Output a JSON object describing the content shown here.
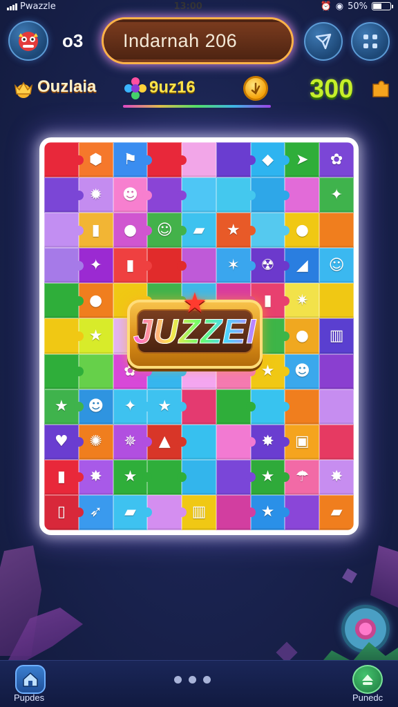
{
  "status_bar": {
    "app_name": "Pwazzle",
    "time": "13:00",
    "battery": "50%",
    "battery_level": 0.5
  },
  "header": {
    "level": "o3",
    "title": "Indarnah 206",
    "player_name": "Ouzlaia",
    "puzzle_code": "9uz16",
    "score": "300"
  },
  "board": {
    "logo_text": "JUZZEI",
    "tiles": [
      {
        "color": "#e8283a",
        "glyph": ""
      },
      {
        "color": "#f5782b",
        "glyph": "⬢"
      },
      {
        "color": "#3a8df0",
        "glyph": "⚑"
      },
      {
        "color": "#e8283a",
        "glyph": ""
      },
      {
        "color": "#f2a6e8",
        "glyph": ""
      },
      {
        "color": "#6a3dd0",
        "glyph": ""
      },
      {
        "color": "#2eb4f0",
        "glyph": "◆"
      },
      {
        "color": "#2fae3a",
        "glyph": "➤"
      },
      {
        "color": "#7b46d6",
        "glyph": "✿"
      },
      {
        "color": "#7b46d6",
        "glyph": ""
      },
      {
        "color": "#c48cf0",
        "glyph": "✹"
      },
      {
        "color": "#f77fcf",
        "glyph": "☻"
      },
      {
        "color": "#8a44d6",
        "glyph": ""
      },
      {
        "color": "#4ec6f5",
        "glyph": ""
      },
      {
        "color": "#44c8ee",
        "glyph": ""
      },
      {
        "color": "#2ea7e8",
        "glyph": ""
      },
      {
        "color": "#e26bd8",
        "glyph": ""
      },
      {
        "color": "#3fb34c",
        "glyph": "✦"
      },
      {
        "color": "#c28ef2",
        "glyph": ""
      },
      {
        "color": "#f2b534",
        "glyph": "▮"
      },
      {
        "color": "#d056d0",
        "glyph": "●"
      },
      {
        "color": "#43b24a",
        "glyph": "☺"
      },
      {
        "color": "#3ec2ef",
        "glyph": "▰"
      },
      {
        "color": "#e85a28",
        "glyph": "★"
      },
      {
        "color": "#55c9ef",
        "glyph": ""
      },
      {
        "color": "#f0c814",
        "glyph": "●"
      },
      {
        "color": "#f07e1e",
        "glyph": ""
      },
      {
        "color": "#a67ae8",
        "glyph": ""
      },
      {
        "color": "#9b2ad2",
        "glyph": "✦"
      },
      {
        "color": "#ef4040",
        "glyph": "▮"
      },
      {
        "color": "#e12b2b",
        "glyph": ""
      },
      {
        "color": "#bf5ad8",
        "glyph": ""
      },
      {
        "color": "#3aa6ee",
        "glyph": "✶"
      },
      {
        "color": "#6c39cc",
        "glyph": "☢"
      },
      {
        "color": "#2a7ee0",
        "glyph": "◢"
      },
      {
        "color": "#3bb8f0",
        "glyph": "☺"
      },
      {
        "color": "#2fae3a",
        "glyph": ""
      },
      {
        "color": "#f07e1e",
        "glyph": "●"
      },
      {
        "color": "#f0c814",
        "glyph": ""
      },
      {
        "color": "#3fb34c",
        "glyph": ""
      },
      {
        "color": "#3fb8e8",
        "glyph": ""
      },
      {
        "color": "#d93aa0",
        "glyph": ""
      },
      {
        "color": "#e8406f",
        "glyph": "▮"
      },
      {
        "color": "#f2e24a",
        "glyph": "✷"
      },
      {
        "color": "#f0c814",
        "glyph": ""
      },
      {
        "color": "#f0c814",
        "glyph": ""
      },
      {
        "color": "#d8eb2a",
        "glyph": "★"
      },
      {
        "color": "#e2b4f0",
        "glyph": ""
      },
      {
        "color": "#e87c20",
        "glyph": ""
      },
      {
        "color": "#f24d8a",
        "glyph": ""
      },
      {
        "color": "#e8283a",
        "glyph": ""
      },
      {
        "color": "#3db548",
        "glyph": ""
      },
      {
        "color": "#f0a820",
        "glyph": "●"
      },
      {
        "color": "#5a3fd0",
        "glyph": "▥"
      },
      {
        "color": "#2fae3a",
        "glyph": ""
      },
      {
        "color": "#66d04a",
        "glyph": ""
      },
      {
        "color": "#d848d8",
        "glyph": "✿"
      },
      {
        "color": "#36b6ee",
        "glyph": ""
      },
      {
        "color": "#f4a6f0",
        "glyph": ""
      },
      {
        "color": "#f47ab0",
        "glyph": ""
      },
      {
        "color": "#f0c814",
        "glyph": "★"
      },
      {
        "color": "#3aa8ec",
        "glyph": "☻"
      },
      {
        "color": "#8a3fd0",
        "glyph": ""
      },
      {
        "color": "#3fb34c",
        "glyph": "★"
      },
      {
        "color": "#2f94e0",
        "glyph": "☻"
      },
      {
        "color": "#3ec2f0",
        "glyph": "✦"
      },
      {
        "color": "#3ec2f0",
        "glyph": "★"
      },
      {
        "color": "#e43a70",
        "glyph": ""
      },
      {
        "color": "#2fae3a",
        "glyph": ""
      },
      {
        "color": "#38c3ef",
        "glyph": ""
      },
      {
        "color": "#f07e1e",
        "glyph": ""
      },
      {
        "color": "#c68df0",
        "glyph": ""
      },
      {
        "color": "#6a3dd0",
        "glyph": "♥"
      },
      {
        "color": "#f07e1e",
        "glyph": "✺"
      },
      {
        "color": "#b14fe0",
        "glyph": "✵"
      },
      {
        "color": "#d83628",
        "glyph": "▲"
      },
      {
        "color": "#37c0ef",
        "glyph": ""
      },
      {
        "color": "#f27ad2",
        "glyph": ""
      },
      {
        "color": "#6a3dd0",
        "glyph": "✸"
      },
      {
        "color": "#f5a41e",
        "glyph": "▣"
      },
      {
        "color": "#e63a62",
        "glyph": ""
      },
      {
        "color": "#e8283a",
        "glyph": "▮"
      },
      {
        "color": "#a85ae8",
        "glyph": "✸"
      },
      {
        "color": "#2fae3a",
        "glyph": "★"
      },
      {
        "color": "#2fae3a",
        "glyph": ""
      },
      {
        "color": "#33b5ec",
        "glyph": ""
      },
      {
        "color": "#7a46d8",
        "glyph": ""
      },
      {
        "color": "#2faa3a",
        "glyph": "★"
      },
      {
        "color": "#f26aa6",
        "glyph": "☂"
      },
      {
        "color": "#c78df0",
        "glyph": "✸"
      },
      {
        "color": "#d8283a",
        "glyph": "▯"
      },
      {
        "color": "#3a9aee",
        "glyph": "➶"
      },
      {
        "color": "#3ec2f0",
        "glyph": "▰"
      },
      {
        "color": "#d48ef0",
        "glyph": ""
      },
      {
        "color": "#f0c814",
        "glyph": "▥"
      },
      {
        "color": "#d23ea0",
        "glyph": ""
      },
      {
        "color": "#2a90e8",
        "glyph": "★"
      },
      {
        "color": "#8a46d8",
        "glyph": ""
      },
      {
        "color": "#f07e1e",
        "glyph": "▰"
      }
    ]
  },
  "bottom_nav": {
    "left_label": "Pupdes",
    "right_label": "Punedc"
  },
  "icons": {
    "avatar": "monster-avatar-icon",
    "share": "share-icon",
    "menu": "grid-menu-icon",
    "player": "crown-icon",
    "puzzle": "flower-icon",
    "coin": "coin-icon",
    "score": "puzzle-piece-icon",
    "home": "home-icon",
    "profile": "person-icon"
  }
}
